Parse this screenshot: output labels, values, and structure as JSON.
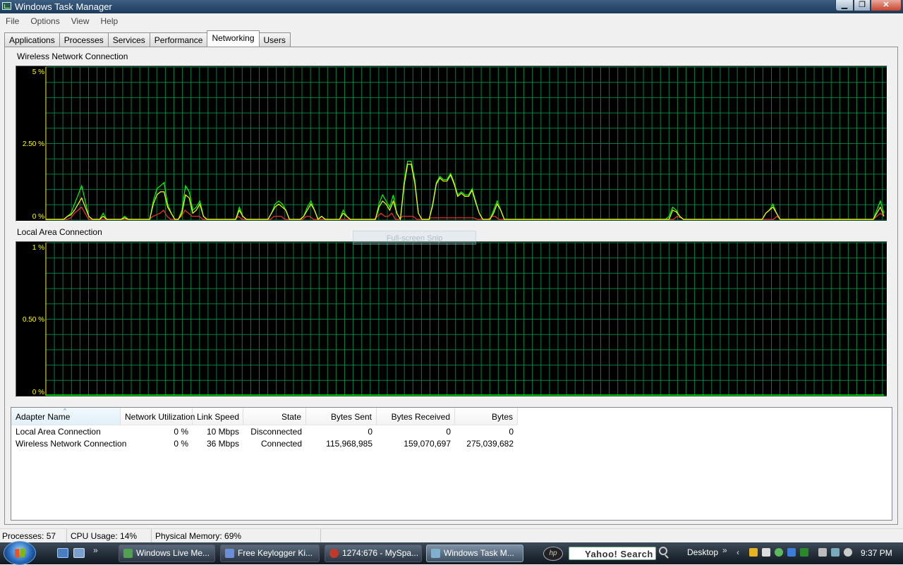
{
  "window": {
    "title": "Windows Task Manager",
    "minimize": "▁",
    "maximize": "❐",
    "close": "✕"
  },
  "menu": [
    "File",
    "Options",
    "View",
    "Help"
  ],
  "tabs": [
    {
      "label": "Applications",
      "active": false
    },
    {
      "label": "Processes",
      "active": false
    },
    {
      "label": "Services",
      "active": false
    },
    {
      "label": "Performance",
      "active": false
    },
    {
      "label": "Networking",
      "active": true
    },
    {
      "label": "Users",
      "active": false
    }
  ],
  "colors": {
    "grid": "#008040",
    "total_line": "#00ff00",
    "sent_line": "#ff3030",
    "received_line": "#ffff00",
    "axis_text": "#ffff00"
  },
  "graphs": [
    {
      "title": "Wireless Network Connection",
      "ymax_label": "5 %",
      "ymid_label": "2.50 %",
      "ymin_label": "0 %"
    },
    {
      "title": "Local Area Connection",
      "ymax_label": "1 %",
      "ymid_label": "0.50 %",
      "ymin_label": "0 %"
    }
  ],
  "chart_data": [
    {
      "type": "line",
      "title": "Wireless Network Connection",
      "ylim": [
        0,
        5
      ],
      "grid": true,
      "series": [
        {
          "values": [
            0,
            0,
            0,
            0,
            0,
            0,
            0.1,
            0.2,
            0.5,
            0.8,
            1.1,
            0.6,
            0.1,
            0,
            0,
            0,
            0.2,
            0,
            0,
            0,
            0,
            0,
            0.1,
            0,
            0,
            0,
            0,
            0,
            0,
            0,
            0.6,
            1.0,
            1.1,
            1.2,
            0.5,
            0.2,
            0,
            0,
            0.3,
            1.1,
            0.9,
            0.3,
            0.4,
            0.6,
            0.1,
            0,
            0,
            0,
            0,
            0,
            0,
            0,
            0,
            0,
            0.4,
            0.1,
            0,
            0,
            0,
            0,
            0,
            0,
            0,
            0.2,
            0.5,
            0.6,
            0.5,
            0.3,
            0,
            0,
            0,
            0,
            0.1,
            0.4,
            0.6,
            0.3,
            0,
            0.1,
            0,
            0,
            0,
            0,
            0,
            0.3,
            0.1,
            0,
            0,
            0,
            0,
            0,
            0,
            0,
            0,
            0.5,
            0.8,
            0.6,
            0.4,
            0.8,
            0.2,
            0,
            1.2,
            1.9,
            1.9,
            1.3,
            0.2,
            0,
            0,
            0,
            0.5,
            1.2,
            1.4,
            1.3,
            1.3,
            1.5,
            1.2,
            0.8,
            0.9,
            0.8,
            0.8,
            1.0,
            0.6,
            0.2,
            0,
            0,
            0,
            0.3,
            0.6,
            0.3,
            0,
            0,
            0,
            0,
            0,
            0,
            0,
            0,
            0,
            0,
            0,
            0,
            0,
            0,
            0,
            0,
            0,
            0,
            0,
            0,
            0,
            0,
            0,
            0,
            0,
            0,
            0,
            0,
            0,
            0,
            0,
            0,
            0,
            0,
            0,
            0,
            0,
            0,
            0,
            0,
            0,
            0,
            0,
            0,
            0,
            0,
            0.1,
            0.4,
            0.3,
            0.1,
            0,
            0,
            0,
            0,
            0,
            0,
            0,
            0,
            0,
            0,
            0,
            0,
            0,
            0,
            0,
            0,
            0,
            0,
            0,
            0,
            0,
            0,
            0,
            0.2,
            0.3,
            0.5,
            0.2,
            0,
            0,
            0,
            0,
            0,
            0,
            0,
            0,
            0,
            0,
            0,
            0,
            0,
            0,
            0,
            0,
            0,
            0,
            0,
            0,
            0,
            0,
            0,
            0,
            0,
            0,
            0,
            0.3,
            0.6,
            0.2
          ]
        },
        {
          "values": [
            0,
            0,
            0,
            0,
            0,
            0,
            0,
            0.05,
            0.2,
            0.3,
            0.4,
            0.2,
            0,
            0,
            0,
            0,
            0,
            0,
            0,
            0,
            0,
            0,
            0,
            0,
            0,
            0,
            0,
            0,
            0,
            0,
            0.1,
            0.15,
            0.2,
            0.3,
            0.1,
            0,
            0,
            0,
            0.1,
            0.3,
            0.2,
            0.1,
            0.1,
            0.1,
            0,
            0,
            0,
            0,
            0,
            0,
            0,
            0,
            0,
            0,
            0.1,
            0,
            0,
            0,
            0,
            0,
            0,
            0,
            0,
            0,
            0.1,
            0.1,
            0.1,
            0,
            0,
            0,
            0,
            0,
            0,
            0.1,
            0.1,
            0,
            0,
            0,
            0,
            0,
            0,
            0,
            0,
            0,
            0,
            0,
            0,
            0,
            0,
            0,
            0,
            0,
            0,
            0.1,
            0.2,
            0.1,
            0.1,
            0.2,
            0,
            0,
            0.1,
            0.1,
            0.1,
            0.1,
            0,
            0,
            0,
            0,
            0.05,
            0.05,
            0.05,
            0.05,
            0.05,
            0.05,
            0.05,
            0.05,
            0.05,
            0.05,
            0.05,
            0.05,
            0.05,
            0,
            0,
            0,
            0,
            0.1,
            0.1,
            0,
            0,
            0,
            0,
            0,
            0,
            0,
            0,
            0,
            0,
            0,
            0,
            0,
            0,
            0,
            0,
            0,
            0,
            0,
            0,
            0,
            0,
            0,
            0,
            0,
            0,
            0,
            0,
            0,
            0,
            0,
            0,
            0,
            0,
            0,
            0,
            0,
            0,
            0,
            0,
            0,
            0,
            0,
            0,
            0,
            0,
            0,
            0,
            0,
            0,
            0.1,
            0.05,
            0,
            0,
            0,
            0,
            0,
            0,
            0,
            0,
            0,
            0,
            0,
            0,
            0,
            0,
            0,
            0,
            0,
            0,
            0,
            0,
            0,
            0,
            0,
            0,
            0,
            0,
            0.1,
            0,
            0,
            0,
            0,
            0,
            0,
            0,
            0,
            0,
            0,
            0,
            0,
            0,
            0,
            0,
            0,
            0,
            0,
            0,
            0,
            0,
            0,
            0,
            0,
            0,
            0,
            0,
            0.1,
            0.2,
            0.1
          ]
        },
        {
          "values": [
            0,
            0,
            0,
            0,
            0,
            0,
            0.1,
            0.15,
            0.3,
            0.5,
            0.7,
            0.4,
            0.1,
            0,
            0,
            0,
            0.1,
            0,
            0,
            0,
            0,
            0,
            0.05,
            0,
            0,
            0,
            0,
            0,
            0,
            0,
            0.5,
            0.8,
            0.9,
            0.9,
            0.4,
            0.2,
            0,
            0,
            0.2,
            0.8,
            0.7,
            0.2,
            0.3,
            0.5,
            0.1,
            0,
            0,
            0,
            0,
            0,
            0,
            0,
            0,
            0,
            0.3,
            0.1,
            0,
            0,
            0,
            0,
            0,
            0,
            0,
            0.2,
            0.4,
            0.5,
            0.4,
            0.3,
            0,
            0,
            0,
            0,
            0.1,
            0.3,
            0.5,
            0.3,
            0,
            0.1,
            0,
            0,
            0,
            0,
            0,
            0.2,
            0.1,
            0,
            0,
            0,
            0,
            0,
            0,
            0,
            0,
            0.4,
            0.6,
            0.5,
            0.3,
            0.6,
            0.2,
            0,
            1.1,
            1.8,
            1.8,
            1.2,
            0.2,
            0,
            0,
            0,
            0.45,
            1.15,
            1.35,
            1.25,
            1.25,
            1.45,
            1.15,
            0.75,
            0.85,
            0.75,
            0.75,
            0.95,
            0.55,
            0.2,
            0,
            0,
            0,
            0.2,
            0.5,
            0.3,
            0,
            0,
            0,
            0,
            0,
            0,
            0,
            0,
            0,
            0,
            0,
            0,
            0,
            0,
            0,
            0,
            0,
            0,
            0,
            0,
            0,
            0,
            0,
            0,
            0,
            0,
            0,
            0,
            0,
            0,
            0,
            0,
            0,
            0,
            0,
            0,
            0,
            0,
            0,
            0,
            0,
            0,
            0,
            0,
            0,
            0,
            0,
            0.3,
            0.25,
            0.1,
            0,
            0,
            0,
            0,
            0,
            0,
            0,
            0,
            0,
            0,
            0,
            0,
            0,
            0,
            0,
            0,
            0,
            0,
            0,
            0,
            0,
            0,
            0,
            0.2,
            0.3,
            0.4,
            0.2,
            0,
            0,
            0,
            0,
            0,
            0,
            0,
            0,
            0,
            0,
            0,
            0,
            0,
            0,
            0,
            0,
            0,
            0,
            0,
            0,
            0,
            0,
            0,
            0,
            0,
            0,
            0,
            0.2,
            0.4,
            0.1
          ]
        }
      ]
    },
    {
      "type": "line",
      "title": "Local Area Connection",
      "ylim": [
        0,
        1
      ],
      "grid": true,
      "series": [
        {
          "values": [
            0,
            0
          ]
        }
      ]
    }
  ],
  "adapters": {
    "columns": [
      {
        "label": "Adapter Name",
        "align": "left"
      },
      {
        "label": "Network Utilization",
        "align": "left"
      },
      {
        "label": "Link Speed",
        "align": "right"
      },
      {
        "label": "State",
        "align": "right"
      },
      {
        "label": "Bytes Sent",
        "align": "right"
      },
      {
        "label": "Bytes Received",
        "align": "right"
      },
      {
        "label": "Bytes",
        "align": "right"
      }
    ],
    "sort_arrow": "^",
    "rows": [
      [
        "Local Area Connection",
        "0 %",
        "10 Mbps",
        "Disconnected",
        "0",
        "0",
        "0"
      ],
      [
        "Wireless Network Connection",
        "0 %",
        "36 Mbps",
        "Connected",
        "115,968,985",
        "159,070,697",
        "275,039,682"
      ]
    ]
  },
  "overlay": {
    "snip_label": "Full-screen Snip"
  },
  "status": {
    "processes": "Processes: 57",
    "cpu": "CPU Usage: 14%",
    "memory": "Physical Memory: 69%"
  },
  "taskbar": {
    "buttons": [
      {
        "label": "Windows Live Me...",
        "icon_color": "#4fa04f",
        "active": false
      },
      {
        "label": "Free Keylogger Ki...",
        "icon_color": "#6b8ed6",
        "active": false
      },
      {
        "label": "1274:676 - MySpa...",
        "icon_color": "#c0392b",
        "active": false
      },
      {
        "label": "Windows Task M...",
        "icon_color": "#7fb0d0",
        "active": true
      }
    ],
    "hp_label": "hp",
    "search_label": "Yahoo! Search",
    "desktop_label": "Desktop",
    "clock": "9:37 PM",
    "chevron": "»",
    "tray_arrow": "‹"
  }
}
